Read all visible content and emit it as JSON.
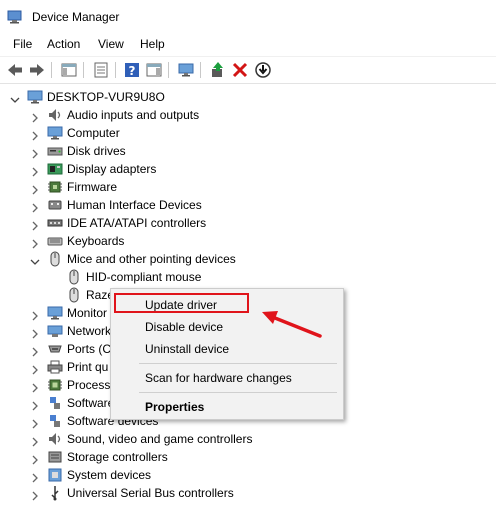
{
  "window": {
    "title": "Device Manager"
  },
  "menu": [
    "File",
    "Action",
    "View",
    "Help"
  ],
  "tree": {
    "root": "DESKTOP-VUR9U8O",
    "items": [
      "Audio inputs and outputs",
      "Computer",
      "Disk drives",
      "Display adapters",
      "Firmware",
      "Human Interface Devices",
      "IDE ATA/ATAPI controllers",
      "Keyboards",
      "Mice and other pointing devices",
      "HID-compliant mouse",
      "Raze",
      "Monitor",
      "Network",
      "Ports (C",
      "Print qu",
      "Processo",
      "Software",
      "Software devices",
      "Sound, video and game controllers",
      "Storage controllers",
      "System devices",
      "Universal Serial Bus controllers"
    ]
  },
  "context_menu": {
    "items": [
      "Update driver",
      "Disable device",
      "Uninstall device",
      "Scan for hardware changes",
      "Properties"
    ]
  },
  "colors": {
    "highlight": "#e0141b",
    "menu_bg": "#f2f2f2"
  }
}
